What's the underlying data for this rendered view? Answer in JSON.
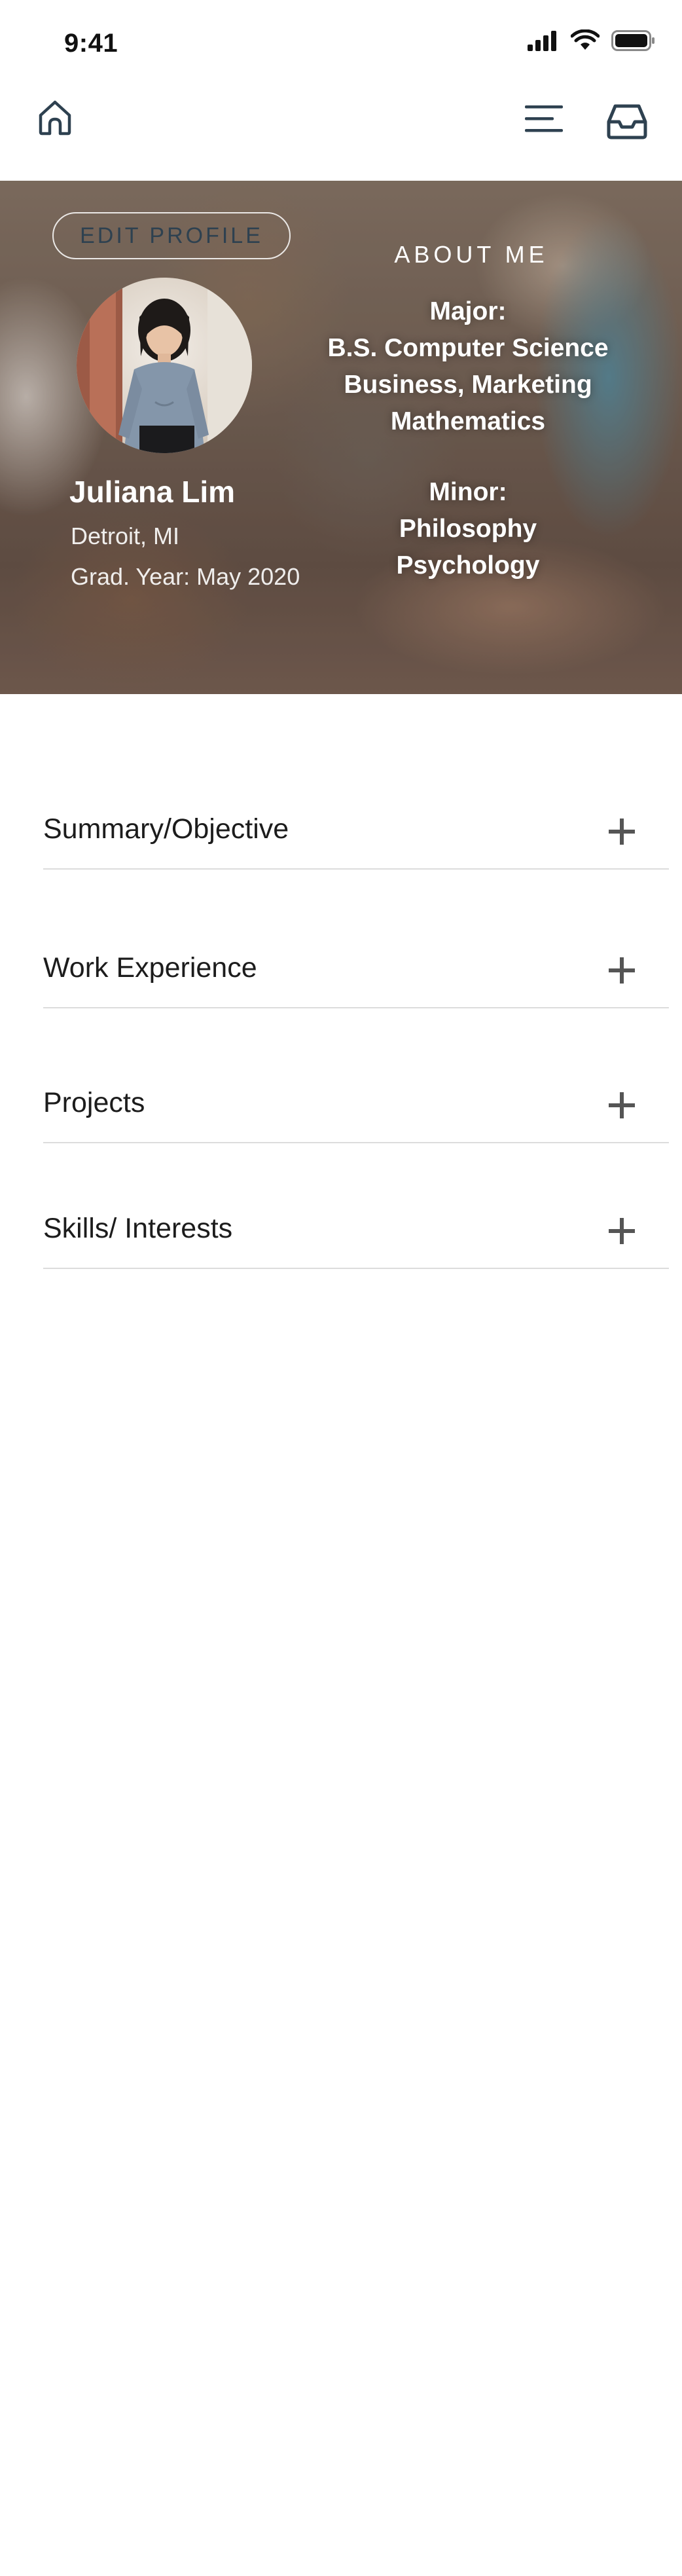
{
  "status_bar": {
    "time": "9:41",
    "icons": [
      "signal-icon",
      "wifi-icon",
      "battery-icon"
    ]
  },
  "nav": {
    "home_icon": "home-icon",
    "menu_icon": "hamburger-menu-icon",
    "inbox_icon": "inbox-tray-icon",
    "icon_color": "#2e4150"
  },
  "profile": {
    "edit_button": "EDIT PROFILE",
    "name": "Juliana Lim",
    "location": "Detroit, MI",
    "grad_year": "Grad. Year: May 2020"
  },
  "about": {
    "title": "ABOUT ME",
    "major_label": "Major:",
    "majors": [
      "B.S. Computer Science",
      "Business, Marketing",
      "Mathematics"
    ],
    "minor_label": "Minor:",
    "minors": [
      "Philosophy",
      "Psychology"
    ]
  },
  "sections": [
    {
      "label": "Summary/Objective",
      "icon": "plus-icon"
    },
    {
      "label": "Work Experience",
      "icon": "plus-icon"
    },
    {
      "label": "Projects",
      "icon": "plus-icon"
    },
    {
      "label": "Skills/ Interests",
      "icon": "plus-icon"
    }
  ]
}
